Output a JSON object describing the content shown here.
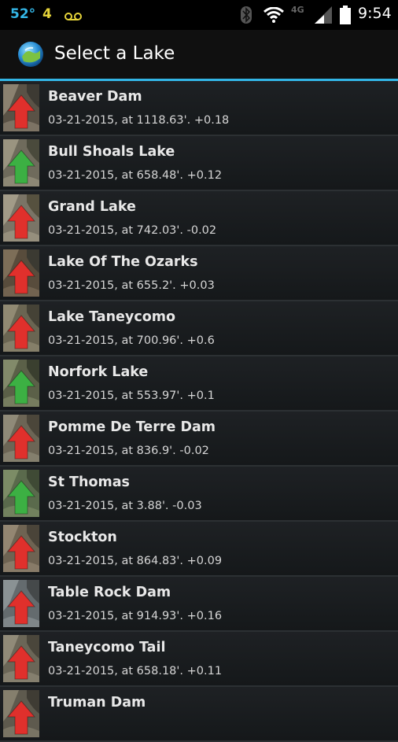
{
  "status_bar": {
    "temperature": "52°",
    "notification_count": "4",
    "time": "9:54",
    "network": "4G"
  },
  "action_bar": {
    "title": "Select a Lake"
  },
  "colors": {
    "accent": "#33b5e5",
    "arrow_up": "#e0302c",
    "arrow_down": "#3cb043"
  },
  "lakes": [
    {
      "name": "Beaver Dam",
      "detail": "03-21-2015, at 1118.63'. +0.18",
      "trend": "up"
    },
    {
      "name": "Bull Shoals Lake",
      "detail": "03-21-2015, at 658.48'. +0.12",
      "trend": "down"
    },
    {
      "name": "Grand Lake",
      "detail": "03-21-2015, at 742.03'. -0.02",
      "trend": "up"
    },
    {
      "name": "Lake Of The Ozarks",
      "detail": "03-21-2015, at 655.2'. +0.03",
      "trend": "up"
    },
    {
      "name": "Lake Taneycomo",
      "detail": "03-21-2015, at 700.96'. +0.6",
      "trend": "up"
    },
    {
      "name": "Norfork Lake",
      "detail": "03-21-2015, at 553.97'. +0.1",
      "trend": "down"
    },
    {
      "name": "Pomme De Terre Dam",
      "detail": "03-21-2015, at 836.9'. -0.02",
      "trend": "up"
    },
    {
      "name": "St Thomas",
      "detail": "03-21-2015, at 3.88'. -0.03",
      "trend": "down"
    },
    {
      "name": "Stockton",
      "detail": "03-21-2015, at 864.83'. +0.09",
      "trend": "up"
    },
    {
      "name": "Table Rock Dam",
      "detail": "03-21-2015, at 914.93'. +0.16",
      "trend": "up"
    },
    {
      "name": "Taneycomo Tail",
      "detail": "03-21-2015, at 658.18'. +0.11",
      "trend": "up"
    },
    {
      "name": "Truman Dam",
      "detail": "",
      "trend": "up"
    }
  ]
}
